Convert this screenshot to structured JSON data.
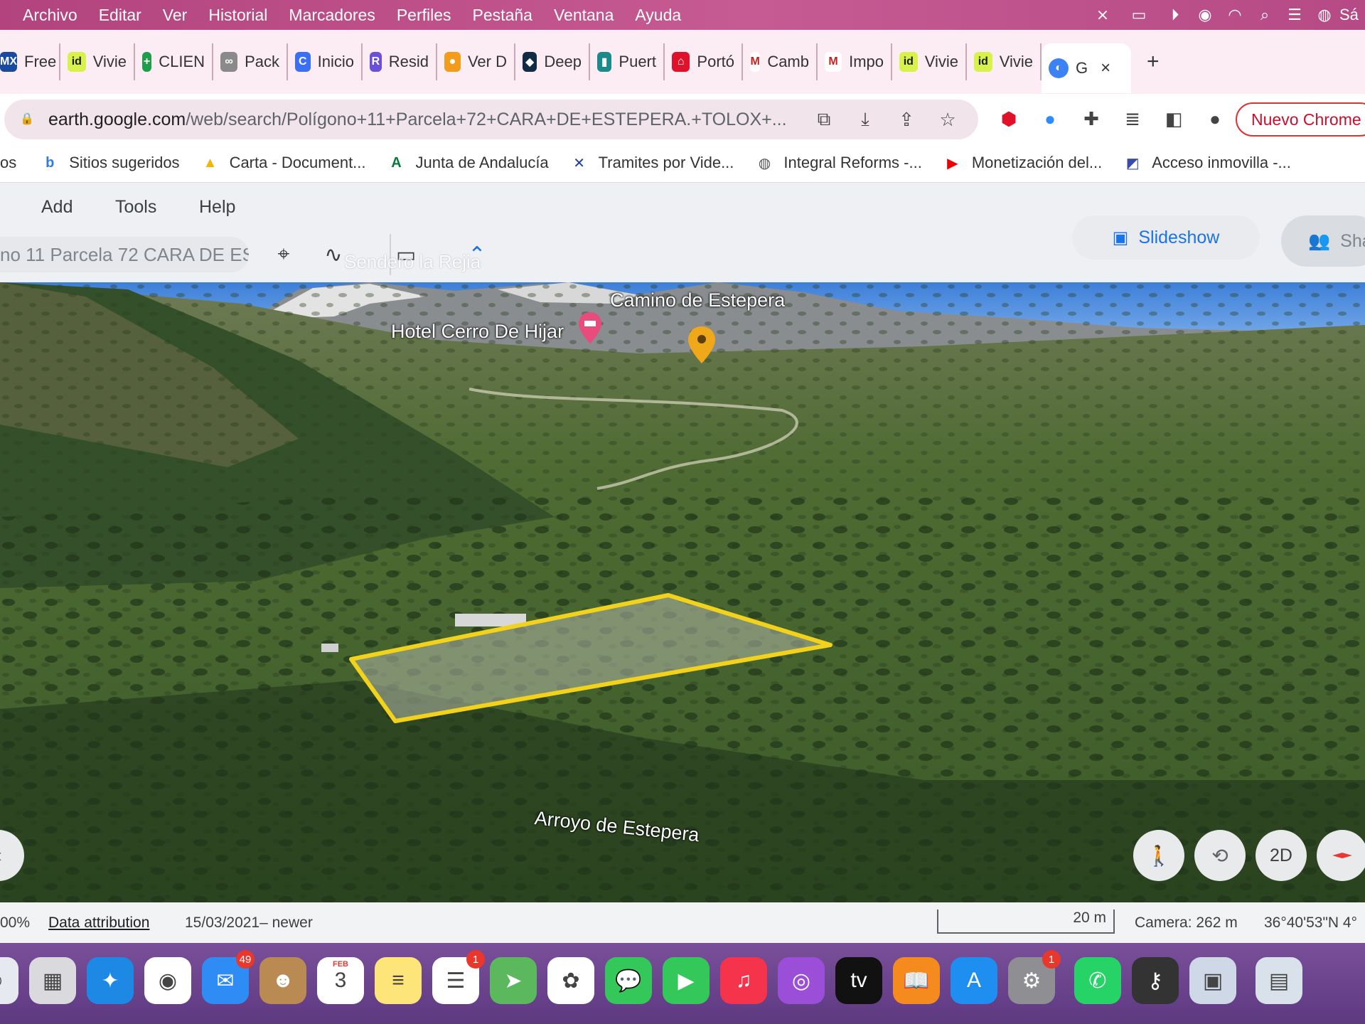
{
  "menubar": {
    "items": [
      "Archivo",
      "Editar",
      "Ver",
      "Historial",
      "Marcadores",
      "Perfiles",
      "Pestaña",
      "Ventana",
      "Ayuda"
    ],
    "right_text": "Sá"
  },
  "tabs": [
    {
      "label": "Free",
      "icon": "mx-icon",
      "color": "#1a4aa0",
      "glyph": "MX"
    },
    {
      "label": "Vivie",
      "icon": "idealista-icon",
      "color": "#d7f24b",
      "glyph": "id"
    },
    {
      "label": "CLIEN",
      "icon": "sheets-icon",
      "color": "#1e9e4a",
      "glyph": "+"
    },
    {
      "label": "Pack",
      "icon": "pack-icon",
      "color": "#8a8a8a",
      "glyph": "∞"
    },
    {
      "label": "Inicio",
      "icon": "circle-c-icon",
      "color": "#3b6ff5",
      "glyph": "C"
    },
    {
      "label": "Resid",
      "icon": "resid-icon",
      "color": "#6b4fd8",
      "glyph": "R"
    },
    {
      "label": "Ver D",
      "icon": "orange-icon",
      "color": "#f59b1c",
      "glyph": "●"
    },
    {
      "label": "Deep",
      "icon": "deepl-icon",
      "color": "#0f2b46",
      "glyph": "◆"
    },
    {
      "label": "Puert",
      "icon": "puert-icon",
      "color": "#1a8a8a",
      "glyph": "▮"
    },
    {
      "label": "Portó",
      "icon": "home-icon",
      "color": "#e0112b",
      "glyph": "⌂"
    },
    {
      "label": "Camb",
      "icon": "gmail-icon",
      "color": "#ffffff",
      "glyph": "M"
    },
    {
      "label": "Impo",
      "icon": "gmail-icon",
      "color": "#ffffff",
      "glyph": "M"
    },
    {
      "label": "Vivie",
      "icon": "idealista-icon",
      "color": "#d7f24b",
      "glyph": "id"
    },
    {
      "label": "Vivie",
      "icon": "idealista-icon",
      "color": "#d7f24b",
      "glyph": "id"
    }
  ],
  "active_tab": {
    "label": "G",
    "close": "×"
  },
  "new_tab": "+",
  "address": {
    "domain": "earth.google.com",
    "path": "/web/search/Polígono+11+Parcela+72+CARA+DE+ESTEPERA.+TOLOX+..."
  },
  "new_chrome_label": "Nuevo Chrome",
  "bookmarks": [
    {
      "label": "os",
      "icon": "",
      "color": "#333"
    },
    {
      "label": "Sitios sugeridos",
      "icon": "bing-icon",
      "color": "#2b7de9",
      "glyph": "b"
    },
    {
      "label": "Carta - Document...",
      "icon": "drive-icon",
      "color": "#f4b400",
      "glyph": "▲"
    },
    {
      "label": "Junta de Andalucía",
      "icon": "junta-icon",
      "color": "#0a7a3b",
      "glyph": "A"
    },
    {
      "label": "Tramites por Vide...",
      "icon": "tramites-icon",
      "color": "#1f3fa0",
      "glyph": "✕"
    },
    {
      "label": "Integral Reforms -...",
      "icon": "globe-icon",
      "color": "#555",
      "glyph": "◍"
    },
    {
      "label": "Monetización del...",
      "icon": "youtube-icon",
      "color": "#e00",
      "glyph": "▶"
    },
    {
      "label": "Acceso inmovilla -...",
      "icon": "inmovilla-icon",
      "color": "#3a4aa8",
      "glyph": "◩"
    }
  ],
  "earth": {
    "menu": [
      "Add",
      "Tools",
      "Help"
    ],
    "search_value": "no 11 Parcela 72 CARA DE ES",
    "slideshow": "Slideshow",
    "share": "Sha",
    "faded_label": "Sendero la Rejia"
  },
  "map_labels": {
    "camino": "Camino de Estepera",
    "hotel": "Hotel Cerro De Hijar",
    "arroyo": "Arroyo de Estepera"
  },
  "controls": {
    "twod": "2D"
  },
  "status": {
    "zoom": "00%",
    "attribution": "Data attribution",
    "date": "15/03/2021– newer",
    "scale": "20 m",
    "camera": "Camera: 262 m",
    "coords": "36°40'53\"N 4°"
  },
  "dock": {
    "items": [
      {
        "icon": "finder-icon",
        "color": "#e6e9ef",
        "glyph": "☺"
      },
      {
        "icon": "launchpad-icon",
        "color": "#d9d9de",
        "glyph": "▦"
      },
      {
        "icon": "safari-icon",
        "color": "#1e88e5",
        "glyph": "✦"
      },
      {
        "icon": "chrome-icon",
        "color": "#ffffff",
        "glyph": "◉"
      },
      {
        "icon": "mail-icon",
        "color": "#2f8cf5",
        "glyph": "✉",
        "badge": "49"
      },
      {
        "icon": "contacts-icon",
        "color": "#b98a52",
        "glyph": "☻"
      },
      {
        "icon": "calendar-icon",
        "color": "#ffffff",
        "glyph": "3",
        "sub": "FEB"
      },
      {
        "icon": "notes-icon",
        "color": "#fde57a",
        "glyph": "≡"
      },
      {
        "icon": "reminders-icon",
        "color": "#ffffff",
        "glyph": "☰",
        "badge": "1"
      },
      {
        "icon": "maps-icon",
        "color": "#5cb85c",
        "glyph": "➤"
      },
      {
        "icon": "photos-icon",
        "color": "#ffffff",
        "glyph": "✿"
      },
      {
        "icon": "messages-icon",
        "color": "#34c759",
        "glyph": "💬"
      },
      {
        "icon": "facetime-icon",
        "color": "#34c759",
        "glyph": "▶"
      },
      {
        "icon": "music-icon",
        "color": "#f5334b",
        "glyph": "♫"
      },
      {
        "icon": "podcasts-icon",
        "color": "#9b4fd8",
        "glyph": "◎"
      },
      {
        "icon": "tv-icon",
        "color": "#111111",
        "glyph": "tv"
      },
      {
        "icon": "books-icon",
        "color": "#f58a1f",
        "glyph": "📖"
      },
      {
        "icon": "appstore-icon",
        "color": "#1f8ef1",
        "glyph": "A"
      },
      {
        "icon": "settings-icon",
        "color": "#8e8e93",
        "glyph": "⚙",
        "badge": "1"
      },
      {
        "icon": "whatsapp-icon",
        "color": "#25d366",
        "glyph": "✆"
      },
      {
        "icon": "keychain-icon",
        "color": "#333333",
        "glyph": "⚷"
      },
      {
        "icon": "preview-icon",
        "color": "#cfd8e6",
        "glyph": "▣"
      },
      {
        "icon": "screenshot-icon",
        "color": "#d9e2ea",
        "glyph": "▤"
      }
    ]
  }
}
